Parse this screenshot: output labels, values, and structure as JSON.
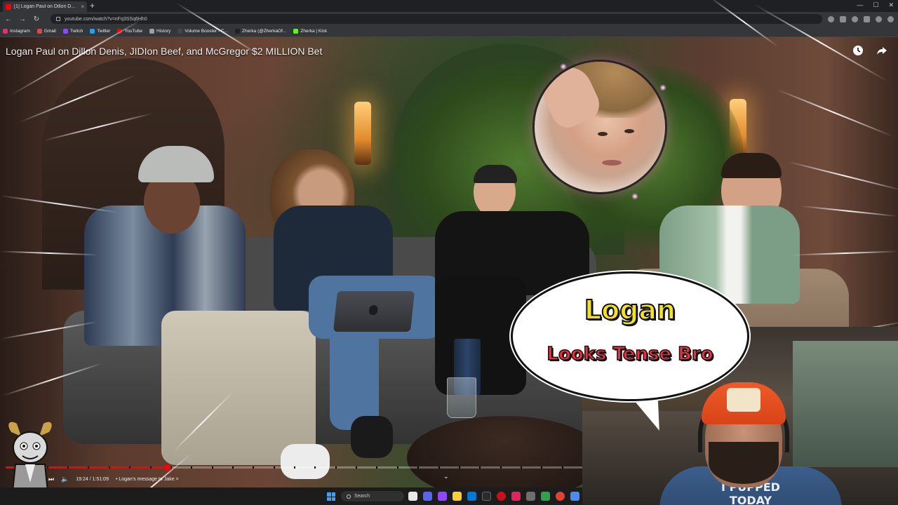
{
  "browser": {
    "tab_title": "[1] Logan Paul on Dillon D...",
    "url": "youtube.com/watch?v=nFq3SSq6Hh0",
    "bookmarks": [
      {
        "label": "Instagram",
        "color": "#e1306c"
      },
      {
        "label": "Gmail",
        "color": "#ea4335"
      },
      {
        "label": "Twitch",
        "color": "#9146ff"
      },
      {
        "label": "Twitter",
        "color": "#1da1f2"
      },
      {
        "label": "YouTube",
        "color": "#ff0000"
      },
      {
        "label": "History",
        "color": "#9aa0a6"
      },
      {
        "label": "Volume Booster - C...",
        "color": "#444"
      },
      {
        "label": "Zherka (@ZherkaOf...",
        "color": "#222"
      },
      {
        "label": "Zherka | Kick",
        "color": "#53fc18"
      }
    ]
  },
  "video": {
    "title": "Logan Paul on Dillon Denis, JIDIon Beef, and McGregor $2 MILLION Bet",
    "watch_later_icon": "clock-icon",
    "share_icon": "share-icon",
    "progress_fraction": 0.28
  },
  "bubble": {
    "line1": "Logan",
    "line2": "Looks Tense Bro",
    "line1_color": "#f5e028",
    "line2_color": "#ef2f3f"
  },
  "player": {
    "time": "19:24 / 1:51:09",
    "chapter": "• Logan's message to Jake >",
    "accent": "#ff0000"
  },
  "taskbar": {
    "search_label": "Search"
  },
  "streamer": {
    "shirt_text": "I PUPPED TODAY"
  }
}
